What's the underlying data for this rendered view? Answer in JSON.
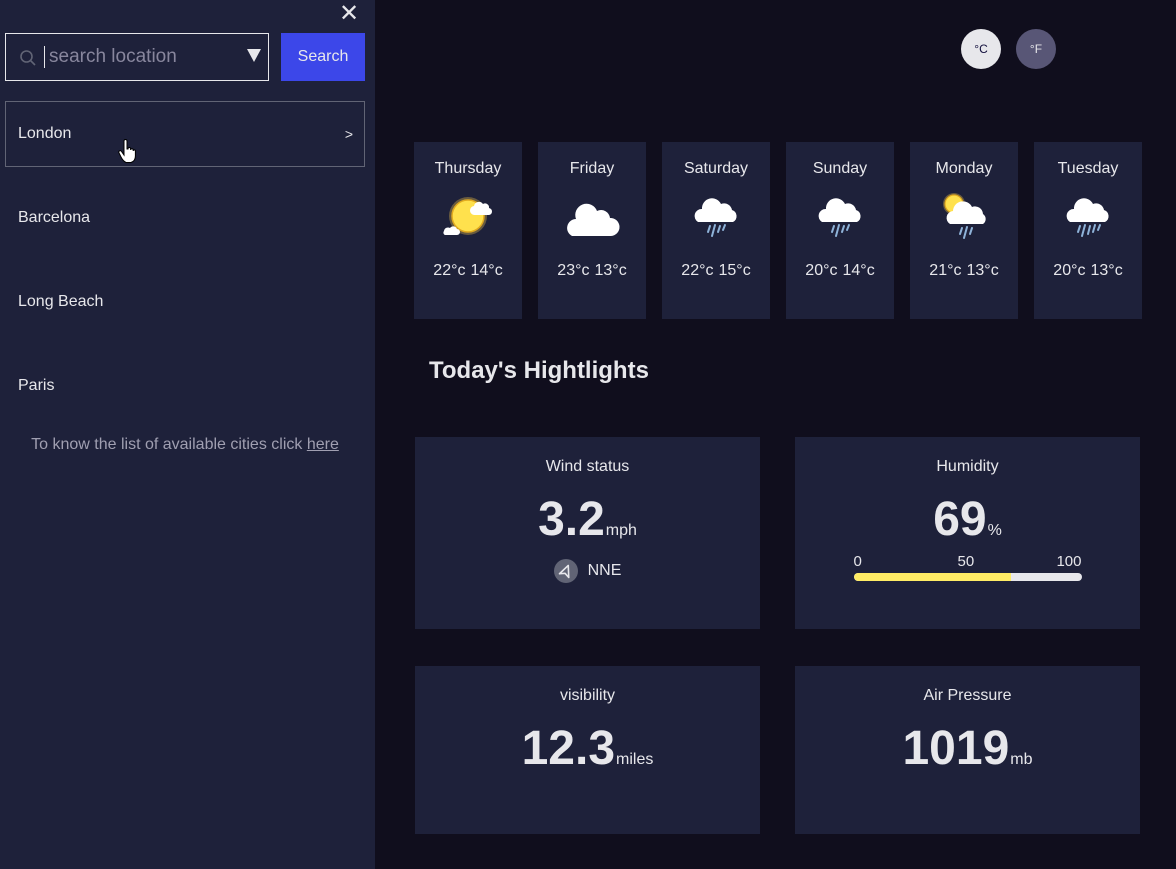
{
  "sidebar": {
    "search": {
      "placeholder": "search location",
      "value": "",
      "button_label": "Search"
    },
    "cities": [
      {
        "name": "London",
        "chevron": ">"
      },
      {
        "name": "Barcelona"
      },
      {
        "name": "Long Beach"
      },
      {
        "name": "Paris"
      }
    ],
    "help": {
      "text": "To know the list of available cities click ",
      "link": "here"
    }
  },
  "units": {
    "celsius": "°C",
    "fahrenheit": "°F",
    "selected": "°C"
  },
  "forecast": [
    {
      "day": "Thursday",
      "icon": "sun-cloud-icon",
      "max": "22°c",
      "min": "14°c"
    },
    {
      "day": "Friday",
      "icon": "cloud-icon",
      "max": "23°c",
      "min": "13°c"
    },
    {
      "day": "Saturday",
      "icon": "rain-icon",
      "max": "22°c",
      "min": "15°c"
    },
    {
      "day": "Sunday",
      "icon": "rain-icon",
      "max": "20°c",
      "min": "14°c"
    },
    {
      "day": "Monday",
      "icon": "sun-rain-icon",
      "max": "21°c",
      "min": "13°c"
    },
    {
      "day": "Tuesday",
      "icon": "rain-icon",
      "max": "20°c",
      "min": "13°c"
    }
  ],
  "highlights": {
    "title": "Today's Hightlights",
    "wind": {
      "label": "Wind status",
      "value": "3.2",
      "unit": "mph",
      "direction": "NNE"
    },
    "humidity": {
      "label": "Humidity",
      "value": "69",
      "unit": "%",
      "percent": 69,
      "scale": [
        "0",
        "50",
        "100"
      ]
    },
    "visibility": {
      "label": "visibility",
      "value": "12.3",
      "unit": "miles"
    },
    "pressure": {
      "label": "Air Pressure",
      "value": "1019",
      "unit": "mb"
    }
  },
  "colors": {
    "sidebar_bg": "#1e213a",
    "main_bg": "#100e1d",
    "accent_blue": "#3c47e9",
    "humidity_fill": "#ffec65",
    "text": "#e7e7eb"
  }
}
